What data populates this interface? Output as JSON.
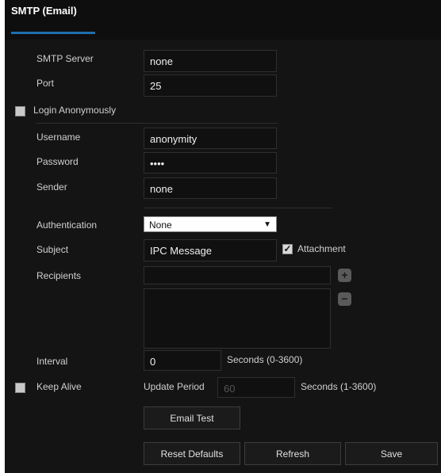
{
  "header": {
    "title": "SMTP (Email)"
  },
  "form": {
    "smtp_server": {
      "label": "SMTP Server",
      "value": "none"
    },
    "port": {
      "label": "Port",
      "value": "25"
    },
    "login_anonymously": {
      "label": "Login Anonymously",
      "checked": false
    },
    "username": {
      "label": "Username",
      "value": "anonymity"
    },
    "password": {
      "label": "Password",
      "value": "••••"
    },
    "sender": {
      "label": "Sender",
      "value": "none"
    },
    "authentication": {
      "label": "Authentication",
      "value": "None",
      "arrow": "▼"
    },
    "subject": {
      "label": "Subject",
      "value": "IPC Message"
    },
    "attachment": {
      "label": "Attachment",
      "checked": true,
      "mark": "✓"
    },
    "recipients": {
      "label": "Recipients",
      "value": "",
      "add": "+",
      "remove": "−"
    },
    "interval": {
      "label": "Interval",
      "value": "0",
      "unit": "Seconds (0-3600)"
    },
    "keep_alive": {
      "label": "Keep Alive",
      "checked": false,
      "update_period_label": "Update Period",
      "update_period_value": "60",
      "unit": "Seconds (1-3600)"
    }
  },
  "buttons": {
    "email_test": "Email Test",
    "reset_defaults": "Reset Defaults",
    "refresh": "Refresh",
    "save": "Save"
  }
}
